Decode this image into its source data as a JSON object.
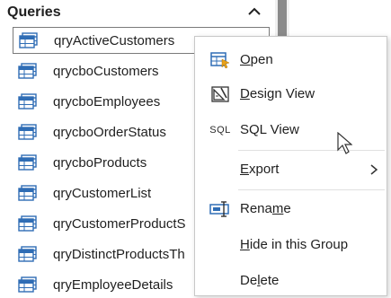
{
  "nav": {
    "header_title": "Queries",
    "collapse_icon": "chevron-up-icon",
    "items": [
      {
        "label": "qryActiveCustomers",
        "selected": true
      },
      {
        "label": "qrycboCustomers"
      },
      {
        "label": "qrycboEmployees"
      },
      {
        "label": "qrycboOrderStatus"
      },
      {
        "label": "qrycboProducts"
      },
      {
        "label": "qryCustomerList"
      },
      {
        "label": "qryCustomerProductS"
      },
      {
        "label": "qryDistinctProductsTh"
      },
      {
        "label": "qryEmployeeDetails"
      }
    ]
  },
  "context_menu": {
    "open": {
      "label": "Open",
      "accel": "O",
      "icon": "open-query-icon"
    },
    "design_view": {
      "label": "Design View",
      "accel": "D",
      "icon": "design-view-icon"
    },
    "sql_view": {
      "label": "SQL View",
      "icon_text": "SQL"
    },
    "export": {
      "label": "Export",
      "accel": "E",
      "has_submenu": true
    },
    "rename": {
      "label": "Rename",
      "accel": "m",
      "icon": "rename-icon"
    },
    "hide_in_group": {
      "label": "Hide in this Group",
      "accel": "H"
    },
    "delete": {
      "label": "Delete",
      "accel": "l"
    }
  },
  "colors": {
    "query_icon_blue": "#2f6db5",
    "selection_border": "#7a7a7a",
    "scrollbar_thumb": "#8a8a8a"
  }
}
